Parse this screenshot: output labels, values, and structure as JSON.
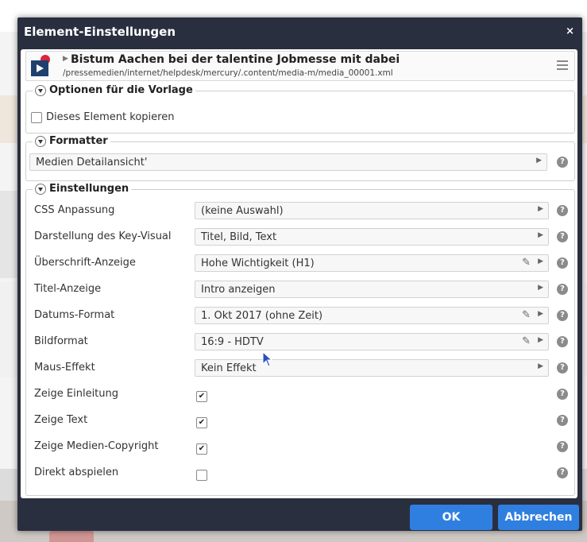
{
  "dialog": {
    "title": "Element-Einstellungen",
    "close_label": "×",
    "element": {
      "title": "Bistum Aachen bei der talentine Jobmesse mit dabei",
      "path": "/pressemedien/internet/helpdesk/mercury/.content/media-m/media_00001.xml"
    },
    "template_options": {
      "legend": "Optionen für die Vorlage",
      "copy_label": "Dieses Element kopieren"
    },
    "formatter": {
      "legend": "Formatter",
      "value": "Medien Detailansicht'"
    },
    "settings": {
      "legend": "Einstellungen",
      "rows": [
        {
          "label": "CSS Anpassung",
          "value": "(keine Auswahl)"
        },
        {
          "label": "Darstellung des Key-Visual",
          "value": "Titel, Bild, Text"
        },
        {
          "label": "Überschrift-Anzeige",
          "value": "Hohe Wichtigkeit (H1)"
        },
        {
          "label": "Titel-Anzeige",
          "value": "Intro anzeigen"
        },
        {
          "label": "Datums-Format",
          "value": "1. Okt 2017 (ohne Zeit)"
        },
        {
          "label": "Bildformat",
          "value": "16:9 - HDTV"
        },
        {
          "label": "Maus-Effekt",
          "value": "Kein Effekt"
        },
        {
          "label": "Zeige Einleitung",
          "checked": true
        },
        {
          "label": "Zeige Text",
          "checked": true
        },
        {
          "label": "Zeige Medien-Copyright",
          "checked": true
        },
        {
          "label": "Direkt abspielen",
          "checked": false
        }
      ]
    },
    "buttons": {
      "ok": "OK",
      "cancel": "Abbrechen"
    }
  },
  "icons": {
    "help": "?",
    "check": "✔",
    "arrow": "▶",
    "pencil": "✎"
  },
  "colors": {
    "dialog_bg": "#2a2f3f",
    "button_blue": "#2f7fe0"
  }
}
